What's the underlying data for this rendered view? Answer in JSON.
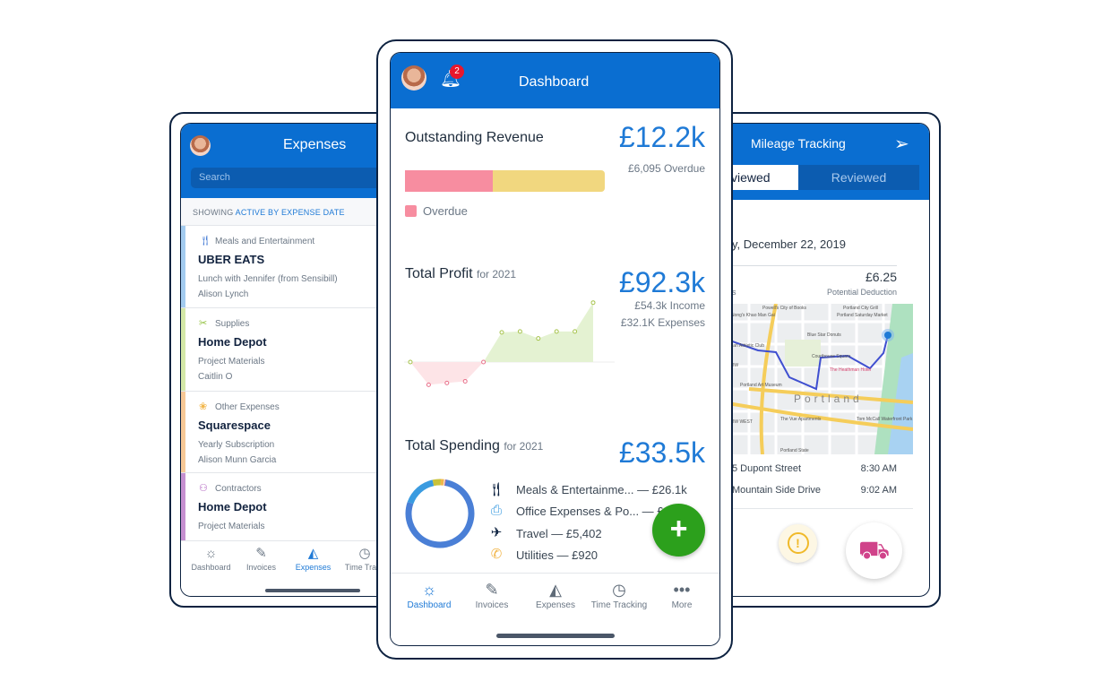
{
  "expenses_screen": {
    "title": "Expenses",
    "search_placeholder": "Search",
    "filter": {
      "prefix": "SHOWING",
      "active": "ACTIVE BY",
      "date": "EXPENSE DATE"
    },
    "items": [
      {
        "category": "Meals and Entertainment",
        "icon": "fork-knife-icon",
        "merchant": "UBER EATS",
        "description": "Lunch with Jennifer (from Sensibill)",
        "person": "Alison Lynch",
        "color": "#a3cbef"
      },
      {
        "category": "Supplies",
        "icon": "tools-icon",
        "merchant": "Home Depot",
        "description": "Project Materials",
        "person": "Caitlin O",
        "color": "#d4e8a8"
      },
      {
        "category": "Other Expenses",
        "icon": "shapes-icon",
        "merchant": "Squarespace",
        "description": "Yearly Subscription",
        "person": "Alison Munn Garcia",
        "color": "#f7c896"
      },
      {
        "category": "Contractors",
        "icon": "people-icon",
        "merchant": "Home Depot",
        "description": "Project Materials",
        "person": "",
        "color": "#c690d0"
      }
    ],
    "tabs": [
      "Dashboard",
      "Invoices",
      "Expenses",
      "Time Track"
    ],
    "active_tab": "Expenses"
  },
  "dashboard_screen": {
    "title": "Dashboard",
    "notification_count": "2",
    "outstanding": {
      "label": "Outstanding Revenue",
      "value": "£12.2k",
      "overdue": "£6,095 Overdue",
      "legend": "Overdue",
      "overdue_fraction": 0.44,
      "colors": {
        "overdue": "#f78da0",
        "remaining": "#f1d77f"
      }
    },
    "profit": {
      "label": "Total Profit",
      "period": "for 2021",
      "value": "£92.3k",
      "income": "£54.3k Income",
      "expenses": "£32.1K Expenses",
      "trend": [
        0,
        -1.3,
        -1.2,
        -1.1,
        0,
        1.7,
        1.75,
        1.35,
        1.75,
        1.75,
        3.4
      ]
    },
    "spending": {
      "label": "Total Spending",
      "period": "for 2021",
      "value": "£33.5k",
      "items": [
        {
          "label": "Meals & Entertainme... — £26.1k",
          "icon": "fork-knife-icon"
        },
        {
          "label": "Office Expenses & Po... — £",
          "icon": "printer-icon"
        },
        {
          "label": "Travel — £5,402",
          "icon": "airplane-icon"
        },
        {
          "label": "Utilities — £920",
          "icon": "phone-icon"
        }
      ],
      "donut": [
        {
          "value": 26.1,
          "color": "#4a7fd6"
        },
        {
          "value": 5.4,
          "color": "#3a9be0"
        },
        {
          "value": 1.3,
          "color": "#c9c23a"
        },
        {
          "value": 0.5,
          "color": "#f2b64a"
        },
        {
          "value": 0.2,
          "color": "#e8e3da"
        },
        {
          "value": 0.15,
          "color": "#d8436e"
        }
      ]
    },
    "fab": "+",
    "tabs": [
      "Dashboard",
      "Invoices",
      "Expenses",
      "Time Tracking",
      "More"
    ],
    "active_tab": "Dashboard"
  },
  "mileage_screen": {
    "title": "Mileage Tracking",
    "segments": [
      "viewed",
      "Reviewed"
    ],
    "date": "y, December 22, 2019",
    "miles_label": "s",
    "deduction": "£6.25",
    "deduction_label": "Potential Deduction",
    "map_labels": [
      "Powell's City of Books",
      "Portland City Grill",
      "Nong's Khao Man Gai",
      "Portland Saturday Market",
      "Blue Star Donuts",
      "ltnomah Athletic Club",
      "OLLOW",
      "Courthouse Square",
      "The Heathman Hotel",
      "Portland Art Museum",
      "Portland",
      "The Vue Apartments",
      "Tom McCall Waterfront Park",
      "OLLOW WEST",
      "Portland State"
    ],
    "stops": [
      {
        "address": "5 Dupont Street",
        "time": "8:30 AM"
      },
      {
        "address": "Mountain Side Drive",
        "time": "9:02 AM"
      }
    ],
    "accent": "#0a6ed1"
  }
}
